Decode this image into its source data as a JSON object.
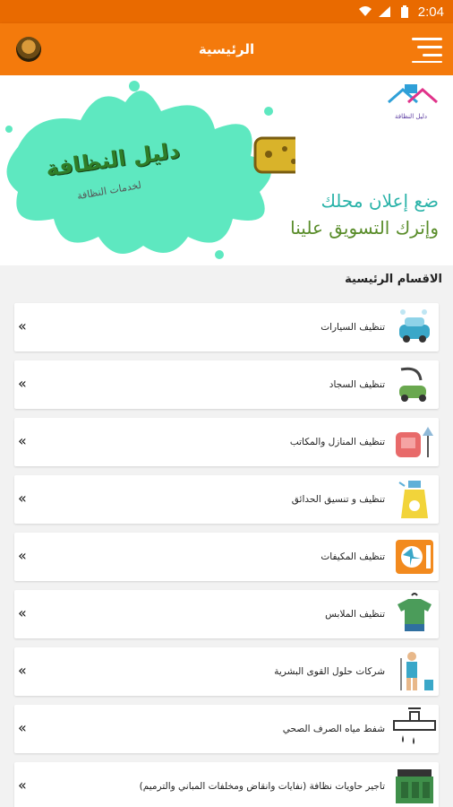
{
  "status_bar": {
    "time": "2:04"
  },
  "app_bar": {
    "title": "الرئيسية"
  },
  "banner": {
    "brand_name": "دليل النظافة",
    "brand_sub": "لخدمات النظافة",
    "tagline_1": "ضع إعلان محلك",
    "tagline_2": "وإترك التسويق علينا",
    "splash_color": "#5ee8c0"
  },
  "section": {
    "title": "الاقسام الرئيسية"
  },
  "categories": [
    {
      "label": "تنظيف السيارات",
      "icon": "car-wash-icon"
    },
    {
      "label": "تنظيف السجاد",
      "icon": "vacuum-cleaner-icon"
    },
    {
      "label": "تنظيف المنازل والمكاتب",
      "icon": "armchair-lamp-icon"
    },
    {
      "label": "تنظيف و تنسيق الحدائق",
      "icon": "spray-bottle-icon"
    },
    {
      "label": "تنظيف المكيفات",
      "icon": "air-conditioner-icon"
    },
    {
      "label": "تنظيف الملابس",
      "icon": "clothes-icon"
    },
    {
      "label": "شركات حلول القوى البشرية",
      "icon": "cleaner-worker-icon"
    },
    {
      "label": "شفط مياه الصرف الصحي",
      "icon": "sewage-pipe-icon"
    },
    {
      "label": "تاجير حاويات نظافة (نفايات وانقاض ومخلفات المباني والترميم)",
      "icon": "dumpster-icon"
    }
  ],
  "colors": {
    "primary": "#f47a0c",
    "status_bar": "#e96a00"
  }
}
